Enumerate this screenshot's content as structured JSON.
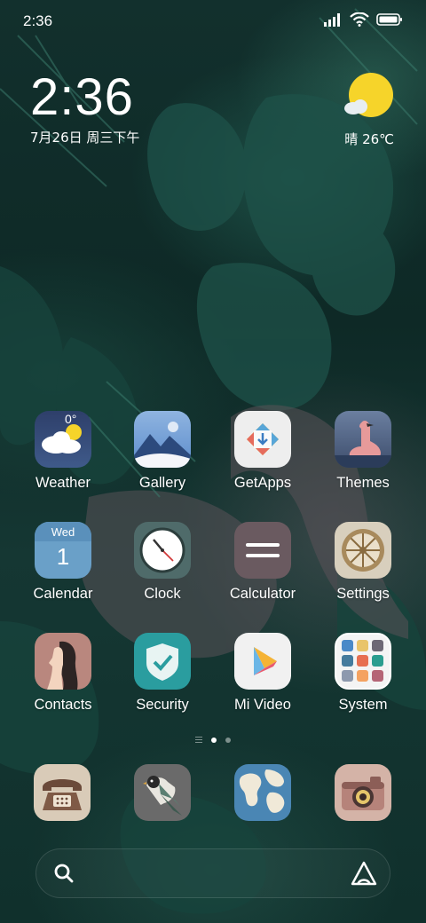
{
  "status_bar": {
    "time": "2:36",
    "icons": [
      "signal-icon",
      "wifi-icon",
      "battery-icon"
    ]
  },
  "clock_widget": {
    "time": "2:36",
    "date": "7月26日 周三下午"
  },
  "weather_widget": {
    "icon": "sun-cloud-icon",
    "temperature": "晴 26℃"
  },
  "apps": [
    {
      "label": "Weather",
      "icon": "weather-icon"
    },
    {
      "label": "Gallery",
      "icon": "gallery-icon"
    },
    {
      "label": "GetApps",
      "icon": "getapps-icon"
    },
    {
      "label": "Themes",
      "icon": "themes-icon"
    },
    {
      "label": "Calendar",
      "icon": "calendar-icon",
      "day_name": "Wed",
      "day_number": "1"
    },
    {
      "label": "Clock",
      "icon": "clock-icon"
    },
    {
      "label": "Calculator",
      "icon": "calculator-icon"
    },
    {
      "label": "Settings",
      "icon": "settings-icon"
    },
    {
      "label": "Contacts",
      "icon": "contacts-icon"
    },
    {
      "label": "Security",
      "icon": "security-icon"
    },
    {
      "label": "Mi Video",
      "icon": "mi-video-icon"
    },
    {
      "label": "System",
      "icon": "system-folder-icon"
    }
  ],
  "page_indicator": {
    "pages": 2,
    "active_page": 1
  },
  "dock": [
    {
      "icon": "phone-icon"
    },
    {
      "icon": "messaging-icon"
    },
    {
      "icon": "browser-icon"
    },
    {
      "icon": "camera-icon"
    }
  ],
  "colors": {
    "wallpaper_dark": "#0e2926",
    "sun": "#f6d42a",
    "security_accent": "#2a9d9f"
  }
}
